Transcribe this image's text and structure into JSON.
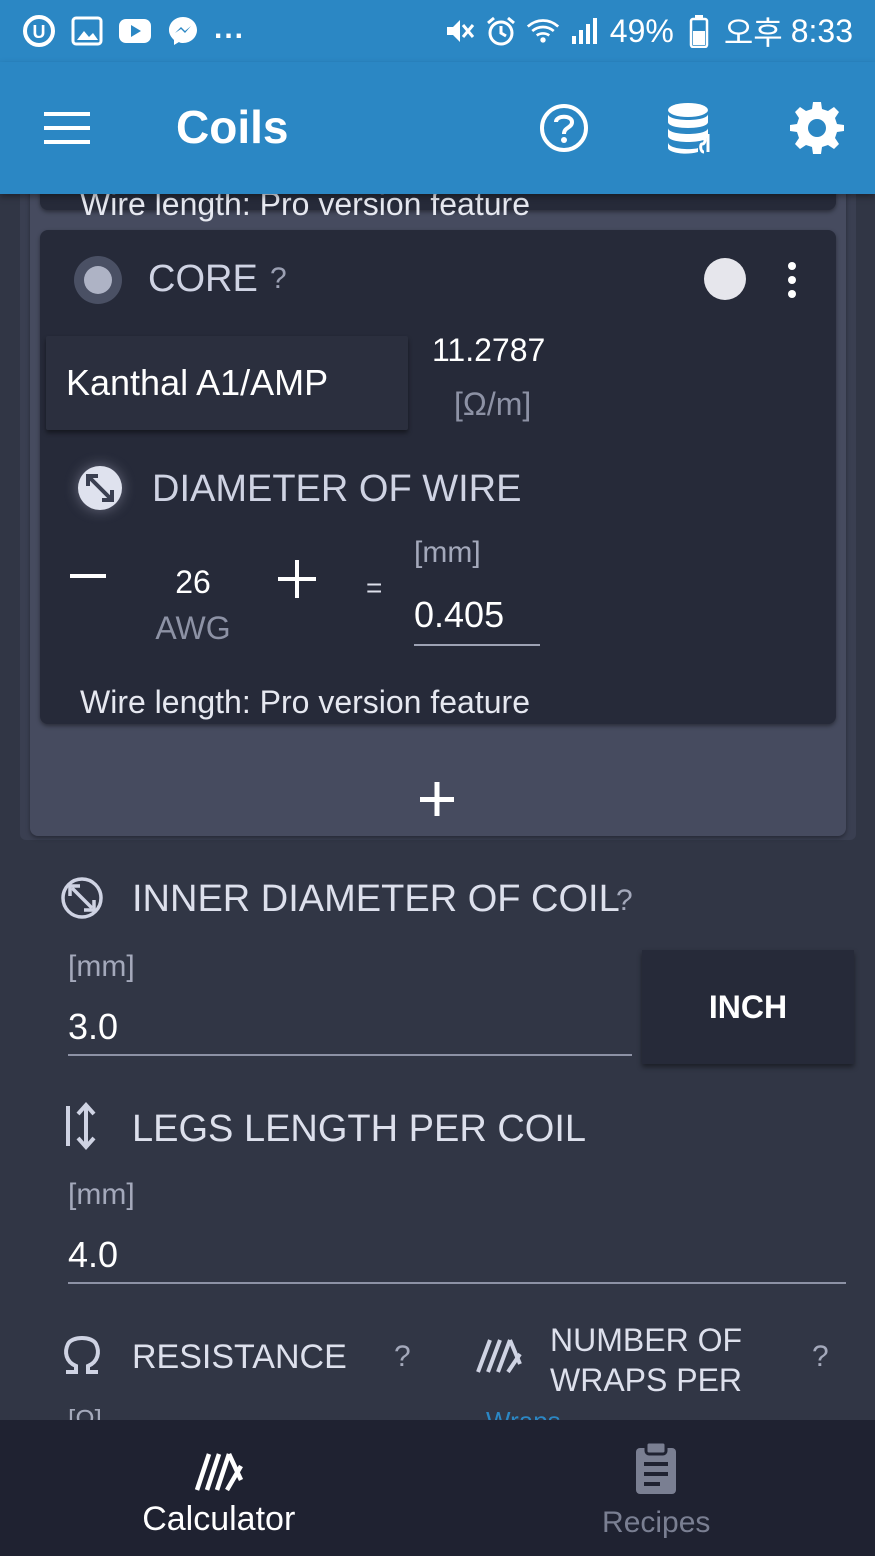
{
  "status_bar": {
    "battery": "49%",
    "ampm": "오후",
    "time": "8:33",
    "more": "..."
  },
  "app_bar": {
    "title": "Coils"
  },
  "previous_wire": {
    "wire_length": "Wire length: Pro version feature"
  },
  "core_wire": {
    "label": "CORE",
    "help": "?",
    "material": "Kanthal A1/AMP",
    "resistivity_value": "11.2787",
    "resistivity_unit": "[Ω/m]",
    "diameter_title": "DIAMETER OF WIRE",
    "gauge_value": "26",
    "gauge_unit": "AWG",
    "equals": "=",
    "diameter_unit": "[mm]",
    "diameter_value": "0.405",
    "wire_length": "Wire length: Pro version feature"
  },
  "inner_diameter": {
    "title": "INNER DIAMETER OF COIL",
    "help": "?",
    "unit": "[mm]",
    "value": "3.0",
    "unit_toggle": "INCH"
  },
  "legs_length": {
    "title": "LEGS LENGTH PER COIL",
    "unit": "[mm]",
    "value": "4.0"
  },
  "resistance": {
    "title": "RESISTANCE",
    "help": "?",
    "unit_partial": "[Ω]"
  },
  "wraps": {
    "title_line1": "NUMBER OF",
    "title_line2": "WRAPS PER",
    "help": "?",
    "unit_partial": "Wraps"
  },
  "bottom_nav": {
    "items": [
      {
        "label": "Calculator",
        "active": true
      },
      {
        "label": "Recipes",
        "active": false
      }
    ]
  },
  "colors": {
    "primary": "#2b87c4",
    "background": "#313645",
    "card": "#262a39",
    "nav": "#1f2231",
    "accent_link": "#2b87c4"
  }
}
